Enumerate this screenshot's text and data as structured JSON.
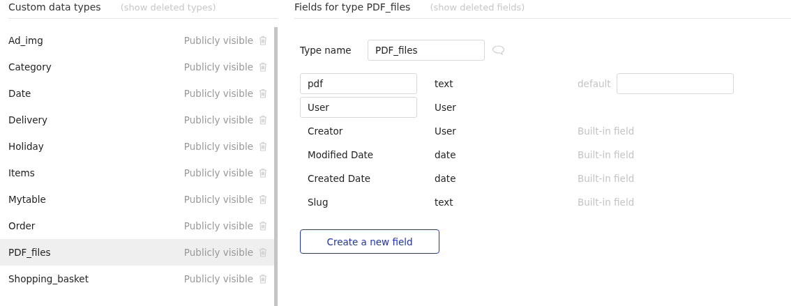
{
  "types_panel": {
    "title": "Custom data types",
    "toggle_link": "(show deleted types)",
    "items": [
      {
        "name": "Ad_img",
        "visibility": "Publicly visible",
        "selected": false
      },
      {
        "name": "Category",
        "visibility": "Publicly visible",
        "selected": false
      },
      {
        "name": "Date",
        "visibility": "Publicly visible",
        "selected": false
      },
      {
        "name": "Delivery",
        "visibility": "Publicly visible",
        "selected": false
      },
      {
        "name": "Holiday",
        "visibility": "Publicly visible",
        "selected": false
      },
      {
        "name": "Items",
        "visibility": "Publicly visible",
        "selected": false
      },
      {
        "name": "Mytable",
        "visibility": "Publicly visible",
        "selected": false
      },
      {
        "name": "Order",
        "visibility": "Publicly visible",
        "selected": false
      },
      {
        "name": "PDF_files",
        "visibility": "Publicly visible",
        "selected": true
      },
      {
        "name": "Shopping_basket",
        "visibility": "Publicly visible",
        "selected": false
      }
    ]
  },
  "fields_panel": {
    "title": "Fields for type PDF_files",
    "toggle_link": "(show deleted fields)",
    "type_name_label": "Type name",
    "type_name_value": "PDF_files",
    "fields": [
      {
        "kind": "editable",
        "name": "pdf",
        "type": "text",
        "default_label": "default"
      },
      {
        "kind": "editable",
        "name": "User",
        "type": "User"
      },
      {
        "kind": "builtin",
        "name": "Creator",
        "type": "User",
        "note": "Built-in field"
      },
      {
        "kind": "builtin",
        "name": "Modified Date",
        "type": "date",
        "note": "Built-in field"
      },
      {
        "kind": "builtin",
        "name": "Created Date",
        "type": "date",
        "note": "Built-in field"
      },
      {
        "kind": "builtin",
        "name": "Slug",
        "type": "text",
        "note": "Built-in field"
      }
    ],
    "create_button": "Create a new field"
  }
}
